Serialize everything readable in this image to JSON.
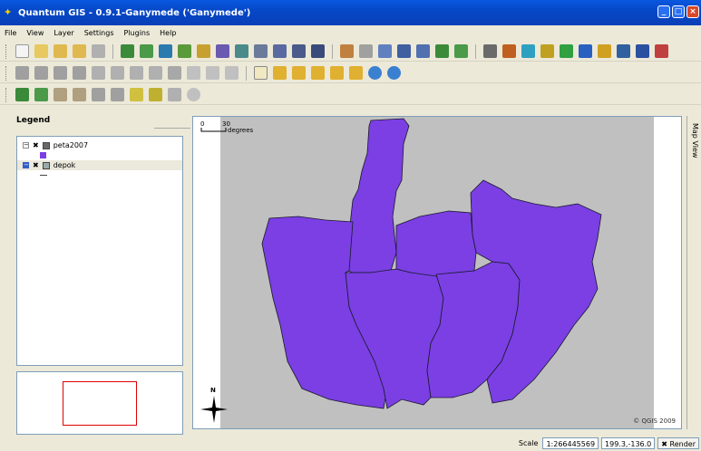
{
  "window": {
    "title": "Quantum GIS - 0.9.1-Ganymede ('Ganymede')"
  },
  "menu": [
    "File",
    "View",
    "Layer",
    "Settings",
    "Plugins",
    "Help"
  ],
  "legend": {
    "tab": "Legend",
    "layers": [
      {
        "name": "peta2007"
      },
      {
        "name": "depok"
      }
    ]
  },
  "map": {
    "tab": "Map View",
    "scale_bar": {
      "start": "0",
      "end": "30",
      "unit": "degrees"
    },
    "copyright": "© QGIS 2009",
    "north_label": "N",
    "fill_color": "#7b3fe4",
    "background_color": "#c0c0c0"
  },
  "status": {
    "scale_label": "Scale",
    "scale_value": "1:266445569",
    "coords": "199.3,-136.0",
    "render_label": "Render"
  },
  "colors": {
    "titlebar": "#0548c8",
    "accent": "#7b3fe4",
    "overview_extent": "#e00000"
  }
}
